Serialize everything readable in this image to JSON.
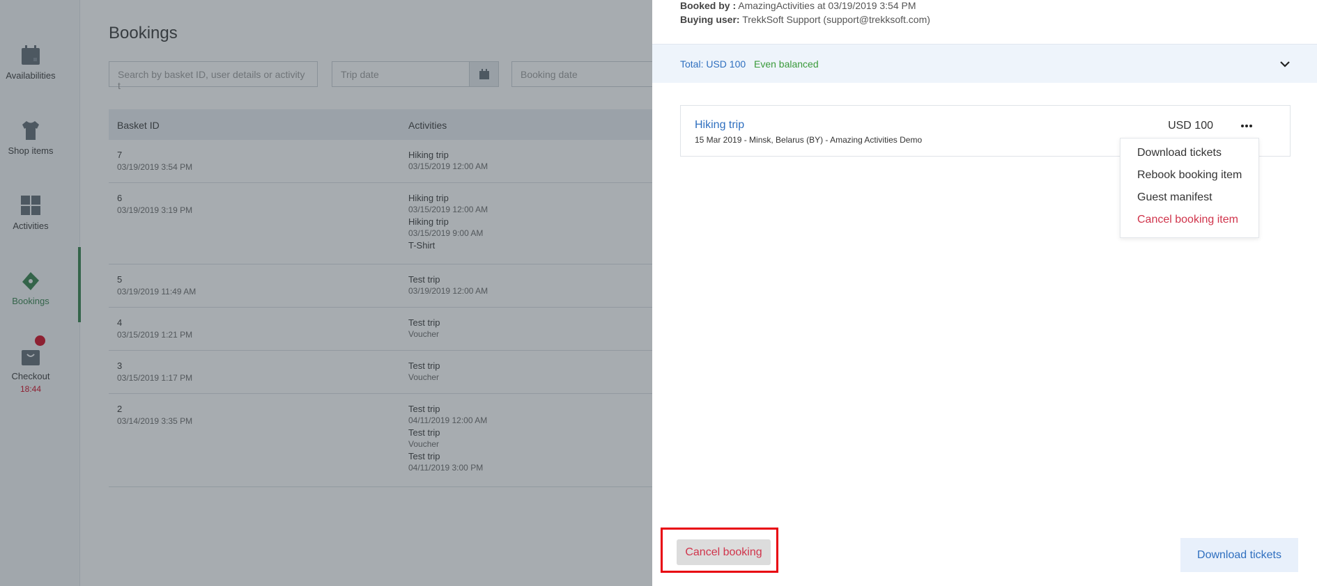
{
  "sidebar": {
    "items": [
      {
        "label": "Availabilities",
        "icon": "calendar-icon"
      },
      {
        "label": "Shop items",
        "icon": "tshirt-icon"
      },
      {
        "label": "Activities",
        "icon": "grid-icon"
      },
      {
        "label": "Bookings",
        "icon": "ticket-icon"
      },
      {
        "label": "Checkout",
        "icon": "shopping-bag-icon"
      }
    ],
    "checkout_timer": "18:44",
    "active_color": "#2f7d46"
  },
  "main": {
    "title": "Bookings",
    "filters": {
      "search_placeholder": "Search by basket ID, user details or activity t",
      "trip_date_placeholder": "Trip date",
      "booking_date_placeholder": "Booking date"
    },
    "table": {
      "headers": [
        "Basket ID",
        "Activities"
      ],
      "rows": [
        {
          "id": "7",
          "date": "03/19/2019 3:54 PM",
          "activities": [
            {
              "name": "Hiking trip",
              "sub": "03/15/2019 12:00 AM"
            }
          ]
        },
        {
          "id": "6",
          "date": "03/19/2019 3:19 PM",
          "activities": [
            {
              "name": "Hiking trip",
              "sub": "03/15/2019 12:00 AM"
            },
            {
              "name": "Hiking trip",
              "sub": "03/15/2019 9:00 AM"
            },
            {
              "name": "T-Shirt",
              "sub": ""
            }
          ]
        },
        {
          "id": "5",
          "date": "03/19/2019 11:49 AM",
          "activities": [
            {
              "name": "Test trip",
              "sub": "03/19/2019 12:00 AM"
            }
          ]
        },
        {
          "id": "4",
          "date": "03/15/2019 1:21 PM",
          "activities": [
            {
              "name": "Test trip",
              "sub": "Voucher"
            }
          ]
        },
        {
          "id": "3",
          "date": "03/15/2019 1:17 PM",
          "activities": [
            {
              "name": "Test trip",
              "sub": "Voucher"
            }
          ]
        },
        {
          "id": "2",
          "date": "03/14/2019 3:35 PM",
          "activities": [
            {
              "name": "Test trip",
              "sub": "04/11/2019 12:00 AM"
            },
            {
              "name": "Test trip",
              "sub": "Voucher"
            },
            {
              "name": "Test trip",
              "sub": "04/11/2019 3:00 PM"
            }
          ]
        }
      ]
    }
  },
  "panel": {
    "booked_by_label": "Booked by :",
    "booked_by_value": "AmazingActivities at 03/19/2019 3:54 PM",
    "buying_user_label": "Buying user:",
    "buying_user_value": "TrekkSoft Support (support@trekksoft.com)",
    "total": "Total: USD 100",
    "balance_status": "Even balanced",
    "item": {
      "title": "Hiking trip",
      "subtitle": "15 Mar 2019 - Minsk, Belarus (BY) - Amazing Activities Demo",
      "price": "USD 100"
    },
    "menu": [
      "Download tickets",
      "Rebook booking item",
      "Guest manifest",
      "Cancel booking item"
    ],
    "cancel_booking_label": "Cancel booking",
    "download_tickets_label": "Download tickets"
  }
}
